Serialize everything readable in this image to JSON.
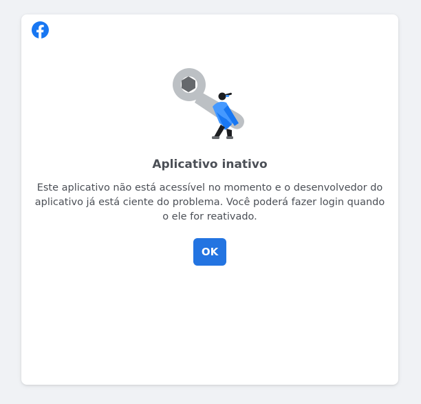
{
  "dialog": {
    "logo_icon": "facebook-logo-icon",
    "illustration_icon": "wrench-maintenance-illustration",
    "title": "Aplicativo inativo",
    "message": "Este aplicativo não está acessível no momento e o desenvolvedor do aplicativo já está ciente do problema. Você poderá fazer login quando o ele for reativado.",
    "ok_label": "OK"
  },
  "colors": {
    "background": "#f0f2f5",
    "card": "#ffffff",
    "text": "#4b4f56",
    "accent": "#2374e1",
    "facebook_blue": "#1877f2"
  }
}
